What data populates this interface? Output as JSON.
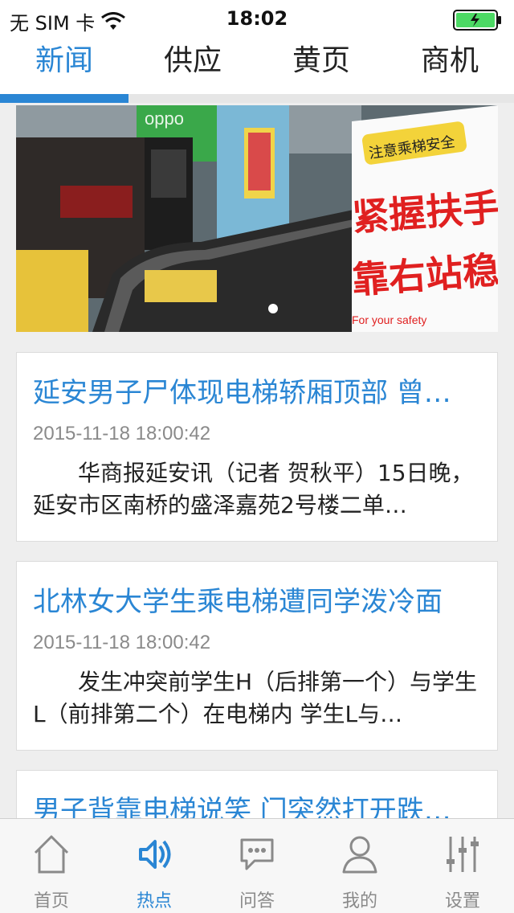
{
  "status_bar": {
    "carrier": "无 SIM 卡",
    "time": "18:02",
    "icons": [
      "wifi-icon",
      "battery-icon"
    ]
  },
  "top_tabs": [
    {
      "label": "新闻",
      "active": true
    },
    {
      "label": "供应",
      "active": false
    },
    {
      "label": "黄页",
      "active": false
    },
    {
      "label": "商机",
      "active": false
    }
  ],
  "banner": {
    "image_texts": {
      "sign_small": "注意乘梯安全",
      "sign_line1": "紧握扶手",
      "sign_line2": "靠右站稳",
      "sign_english": "For your safety",
      "logo": "oppo"
    },
    "page_count": 1,
    "current_page": 1
  },
  "news": [
    {
      "title": "延安男子尸体现电梯轿厢顶部 曾…",
      "date": "2015-11-18 18:00:42",
      "summary": "华商报延安讯（记者 贺秋平）15日晚，延安市区南桥的盛泽嘉苑2号楼二单…"
    },
    {
      "title": "北林女大学生乘电梯遭同学泼冷面",
      "date": "2015-11-18 18:00:42",
      "summary": "发生冲突前学生H（后排第一个）与学生L（前排第二个）在电梯内 学生L与…"
    },
    {
      "title": "男子背靠电梯说笑 门突然打开跌…",
      "date": "",
      "summary": ""
    }
  ],
  "bottom_nav": [
    {
      "label": "首页",
      "icon": "home-icon",
      "active": false
    },
    {
      "label": "热点",
      "icon": "speaker-icon",
      "active": true
    },
    {
      "label": "问答",
      "icon": "chat-icon",
      "active": false
    },
    {
      "label": "我的",
      "icon": "user-icon",
      "active": false
    },
    {
      "label": "设置",
      "icon": "sliders-icon",
      "active": false
    }
  ],
  "colors": {
    "accent": "#2a86d4",
    "background": "#eeeeee",
    "inactive": "#8a8a8a",
    "battery": "#4cd964"
  }
}
